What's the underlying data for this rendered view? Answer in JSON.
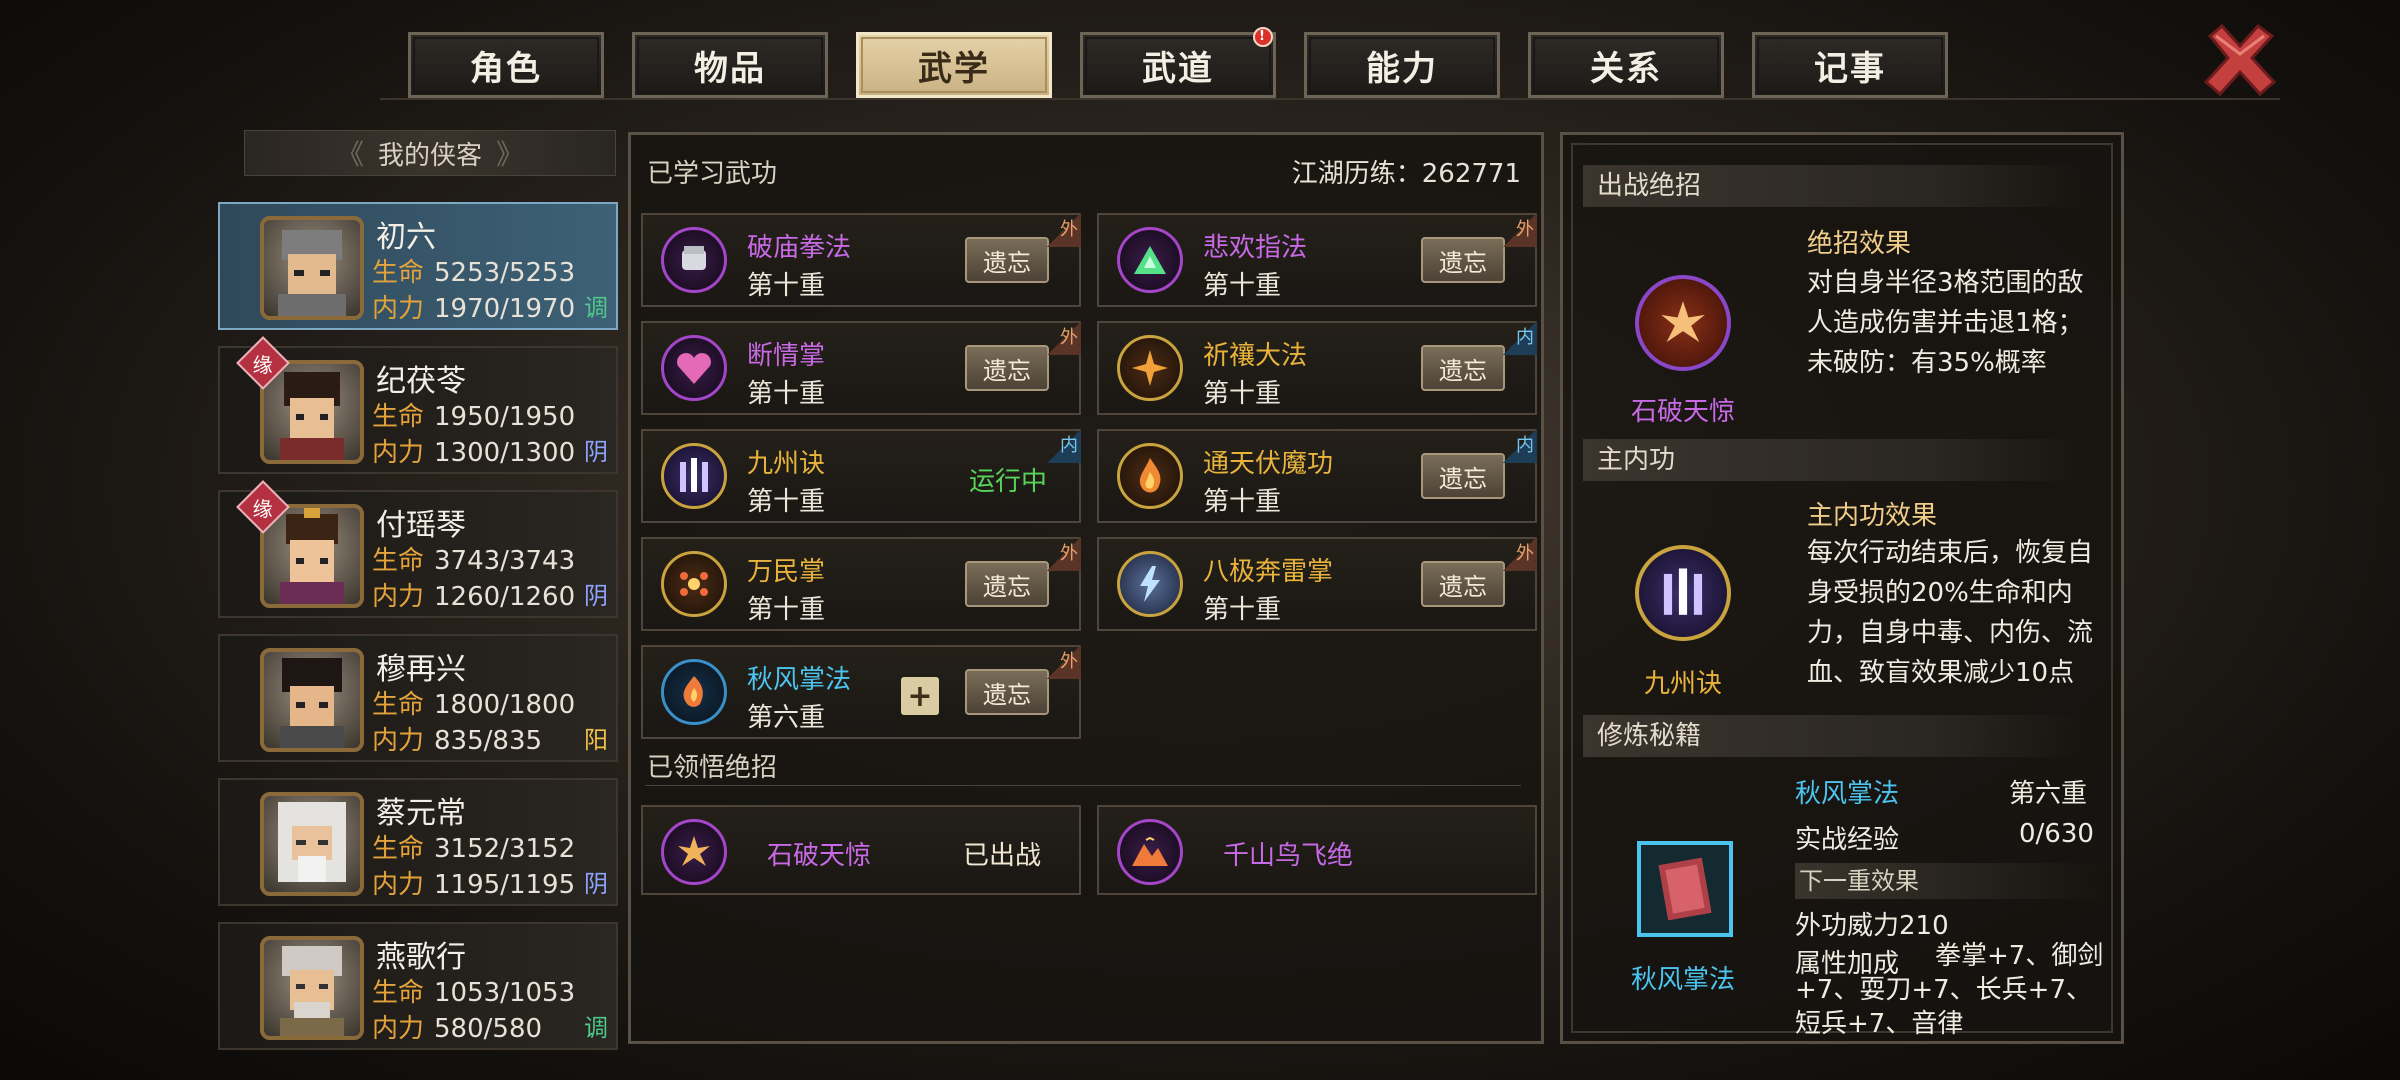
{
  "tabs": [
    {
      "label": "角色",
      "active": false
    },
    {
      "label": "物品",
      "active": false
    },
    {
      "label": "武学",
      "active": true
    },
    {
      "label": "武道",
      "active": false,
      "notice": "!"
    },
    {
      "label": "能力",
      "active": false
    },
    {
      "label": "关系",
      "active": false
    },
    {
      "label": "记事",
      "active": false
    }
  ],
  "roster": {
    "title": "我的侠客",
    "heroes": [
      {
        "name": "初六",
        "hp_label": "生命",
        "hp": "5253/5253",
        "mp_label": "内力",
        "mp": "1970/1970",
        "attr": "调",
        "attr_color": "#4fc98a",
        "tag": "",
        "active": true
      },
      {
        "name": "纪茯苓",
        "hp_label": "生命",
        "hp": "1950/1950",
        "mp_label": "内力",
        "mp": "1300/1300",
        "attr": "阴",
        "attr_color": "#8fa4ff",
        "tag": "缘",
        "active": false
      },
      {
        "name": "付瑶琴",
        "hp_label": "生命",
        "hp": "3743/3743",
        "mp_label": "内力",
        "mp": "1260/1260",
        "attr": "阴",
        "attr_color": "#8fa4ff",
        "tag": "缘",
        "active": false
      },
      {
        "name": "穆再兴",
        "hp_label": "生命",
        "hp": "1800/1800",
        "mp_label": "内力",
        "mp": "835/835",
        "attr": "阳",
        "attr_color": "#f0c24a",
        "tag": "",
        "active": false
      },
      {
        "name": "蔡元常",
        "hp_label": "生命",
        "hp": "3152/3152",
        "mp_label": "内力",
        "mp": "1195/1195",
        "attr": "阴",
        "attr_color": "#8fa4ff",
        "tag": "",
        "active": false
      },
      {
        "name": "燕歌行",
        "hp_label": "生命",
        "hp": "1053/1053",
        "mp_label": "内力",
        "mp": "580/580",
        "attr": "调",
        "attr_color": "#4fc98a",
        "tag": "",
        "active": false
      }
    ]
  },
  "learned": {
    "title": "已学习武功",
    "experience_label": "江湖历练：262771",
    "forget_label": "遗忘",
    "running_label": "运行中",
    "skills": [
      {
        "name": "破庙拳法",
        "level": "第十重",
        "type": "外",
        "color": "#c86ae6",
        "icon": "fist-icon",
        "running": false
      },
      {
        "name": "悲欢指法",
        "level": "第十重",
        "type": "外",
        "color": "#c86ae6",
        "icon": "finger-icon",
        "running": false
      },
      {
        "name": "断情掌",
        "level": "第十重",
        "type": "外",
        "color": "#c86ae6",
        "icon": "heart-palm-icon",
        "running": false
      },
      {
        "name": "祈禳大法",
        "level": "第十重",
        "type": "内",
        "color": "#e8b33c",
        "icon": "ritual-icon",
        "running": false
      },
      {
        "name": "九州诀",
        "level": "第十重",
        "type": "内",
        "color": "#e8b33c",
        "icon": "pillars-icon",
        "running": true
      },
      {
        "name": "通天伏魔功",
        "level": "第十重",
        "type": "内",
        "color": "#e8b33c",
        "icon": "flame-icon",
        "running": false
      },
      {
        "name": "万民掌",
        "level": "第十重",
        "type": "外",
        "color": "#e8b33c",
        "icon": "burst-icon",
        "running": false
      },
      {
        "name": "八极奔雷掌",
        "level": "第十重",
        "type": "外",
        "color": "#e8b33c",
        "icon": "thunder-palm-icon",
        "running": false
      },
      {
        "name": "秋风掌法",
        "level": "第六重",
        "type": "外",
        "color": "#4cc4f0",
        "icon": "wind-palm-icon",
        "running": false
      }
    ]
  },
  "ultimates": {
    "title": "已领悟绝招",
    "items": [
      {
        "name": "石破天惊",
        "status": "已出战"
      },
      {
        "name": "千山鸟飞绝",
        "status": ""
      }
    ]
  },
  "detail": {
    "battle_title": "出战绝招",
    "battle_skill": "石破天惊",
    "effect_title": "绝招效果",
    "effect_text": "对自身半径3格范围的敌人造成伤害并击退1格；未破防：有35%概率",
    "inner_title": "主内功",
    "inner_skill": "九州诀",
    "inner_effect_title": "主内功效果",
    "inner_effect_text": "每次行动结束后，恢复自身受损的20%生命和内力，自身中毒、内伤、流血、致盲效果减少10点",
    "manual_title": "修炼秘籍",
    "manual_skill": "秋风掌法",
    "manual_level": "第六重",
    "exp_label": "实战经验",
    "exp_value": "0/630",
    "next_title": "下一重效果",
    "power": "外功威力210",
    "attr_label": "属性加成",
    "attr_text": "拳掌+7、御剑+7、耍刀+7、长兵+7、短兵+7、音律"
  }
}
